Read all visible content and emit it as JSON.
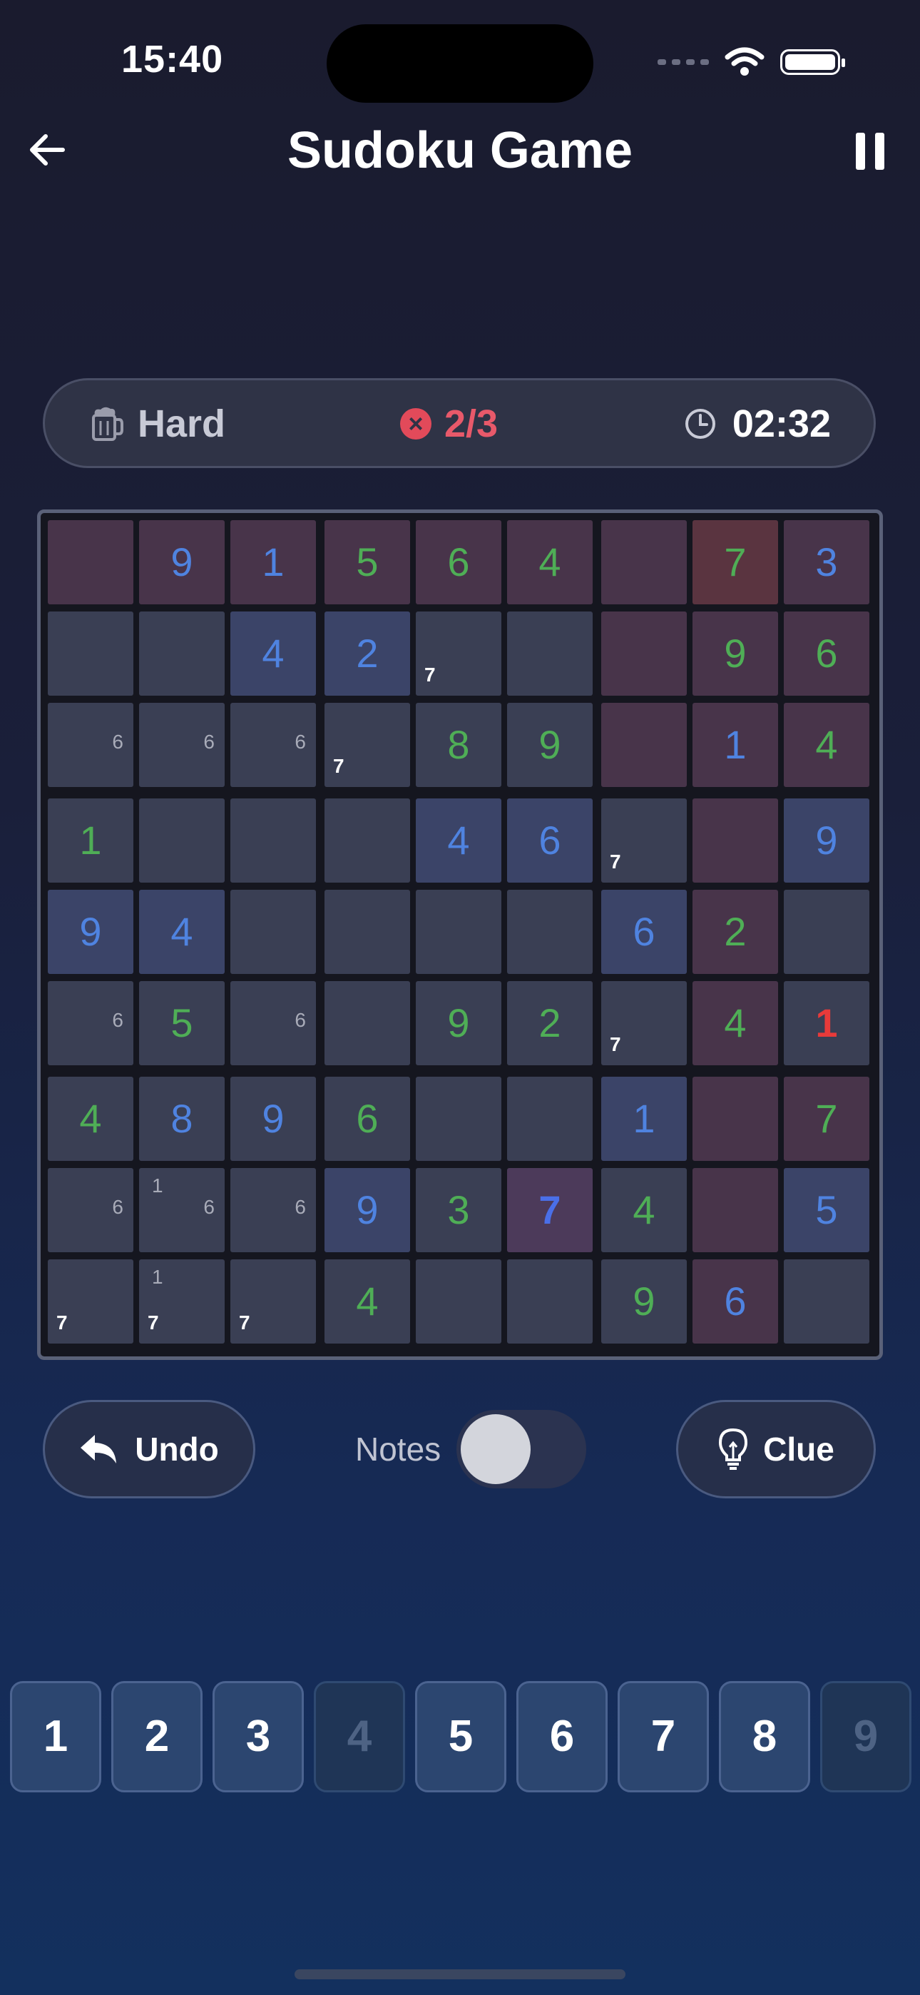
{
  "status_bar": {
    "time": "15:40"
  },
  "header": {
    "title": "Sudoku Game"
  },
  "info": {
    "difficulty": "Hard",
    "mistakes": "2/3",
    "timer": "02:32",
    "mistake_icon": "×"
  },
  "board": {
    "rows": [
      [
        "",
        "9",
        "1",
        "5",
        "6",
        "4",
        "",
        "7",
        "3"
      ],
      [
        "",
        "",
        "4",
        "2",
        "",
        "",
        "",
        "9",
        "6"
      ],
      [
        "",
        "",
        "",
        "",
        "8",
        "9",
        "",
        "1",
        "4"
      ],
      [
        "1",
        "",
        "",
        "",
        "4",
        "6",
        "",
        "",
        "9"
      ],
      [
        "9",
        "4",
        "",
        "",
        "",
        "",
        "6",
        "2",
        ""
      ],
      [
        "",
        "5",
        "",
        "",
        "9",
        "2",
        "",
        "4",
        "1"
      ],
      [
        "4",
        "8",
        "9",
        "6",
        "",
        "",
        "1",
        "",
        "7"
      ],
      [
        "",
        "",
        "",
        "9",
        "3",
        "7",
        "4",
        "",
        "5"
      ],
      [
        "",
        "",
        "",
        "4",
        "",
        "",
        "9",
        "6",
        ""
      ]
    ],
    "kind": [
      [
        "",
        "user",
        "user",
        "given",
        "given",
        "given",
        "",
        "given",
        "user"
      ],
      [
        "",
        "",
        "user",
        "user",
        "",
        "",
        "",
        "given",
        "given"
      ],
      [
        "",
        "",
        "",
        "",
        "given",
        "given",
        "",
        "user",
        "given"
      ],
      [
        "given",
        "",
        "",
        "",
        "user",
        "user",
        "",
        "",
        "user"
      ],
      [
        "user",
        "user",
        "",
        "",
        "",
        "",
        "user",
        "given",
        ""
      ],
      [
        "",
        "given",
        "",
        "",
        "given",
        "given",
        "",
        "given",
        "error"
      ],
      [
        "given",
        "user",
        "user",
        "given",
        "",
        "",
        "user",
        "",
        "given"
      ],
      [
        "",
        "",
        "",
        "user",
        "given",
        "selected",
        "given",
        "",
        "user"
      ],
      [
        "",
        "",
        "",
        "given",
        "",
        "",
        "given",
        "user",
        ""
      ]
    ],
    "bg": [
      [
        "r",
        "r",
        "r",
        "r",
        "r",
        "r",
        "r",
        "hot",
        "r"
      ],
      [
        "n",
        "n",
        "b",
        "b",
        "n",
        "n",
        "r",
        "r",
        "r"
      ],
      [
        "n",
        "n",
        "n",
        "n",
        "n",
        "n",
        "r",
        "r",
        "r"
      ],
      [
        "n",
        "n",
        "n",
        "n",
        "b",
        "b",
        "n",
        "r",
        "b"
      ],
      [
        "b",
        "b",
        "n",
        "n",
        "n",
        "n",
        "b",
        "r",
        "n"
      ],
      [
        "n",
        "n",
        "n",
        "n",
        "n",
        "n",
        "n",
        "r",
        "n"
      ],
      [
        "n",
        "n",
        "n",
        "n",
        "n",
        "n",
        "b",
        "r",
        "r"
      ],
      [
        "n",
        "n",
        "n",
        "b",
        "n",
        "sel",
        "n",
        "r",
        "b"
      ],
      [
        "n",
        "n",
        "n",
        "n",
        "n",
        "n",
        "n",
        "r",
        "n"
      ]
    ],
    "notes": [
      [
        "",
        "",
        "",
        "",
        "",
        "",
        "",
        "",
        ""
      ],
      [
        "",
        "",
        "",
        "",
        "7",
        "",
        "",
        "",
        ""
      ],
      [
        "6",
        "6",
        "6",
        "7",
        "",
        "",
        "",
        "",
        ""
      ],
      [
        "",
        "",
        "",
        "",
        "",
        "",
        "7",
        "",
        ""
      ],
      [
        "",
        "",
        "",
        "",
        "",
        "",
        "",
        "",
        ""
      ],
      [
        "6",
        "",
        "6",
        "",
        "",
        "",
        "7",
        "",
        ""
      ],
      [
        "",
        "",
        "",
        "",
        "",
        "",
        "",
        "",
        ""
      ],
      [
        "6",
        "1 6",
        "6",
        "",
        "",
        "",
        "",
        "",
        ""
      ],
      [
        "7",
        "1 7",
        "7",
        "",
        "",
        "",
        "",
        "",
        ""
      ]
    ]
  },
  "controls": {
    "undo_label": "Undo",
    "notes_label": "Notes",
    "notes_on": false,
    "clue_label": "Clue"
  },
  "numpad": {
    "keys": [
      "1",
      "2",
      "3",
      "4",
      "5",
      "6",
      "7",
      "8",
      "9"
    ],
    "disabled": [
      false,
      false,
      false,
      true,
      false,
      false,
      false,
      false,
      true
    ]
  },
  "colors": {
    "given": "#4fae56",
    "user": "#4f83e0",
    "error": "#e83a3a",
    "selected": "#4a6fe8",
    "cell_neutral": "#3a3f54",
    "cell_blue": "#3b4468",
    "cell_red": "#48344a",
    "cell_hot": "#5a3440",
    "cell_selected": "#4c3a5a"
  }
}
